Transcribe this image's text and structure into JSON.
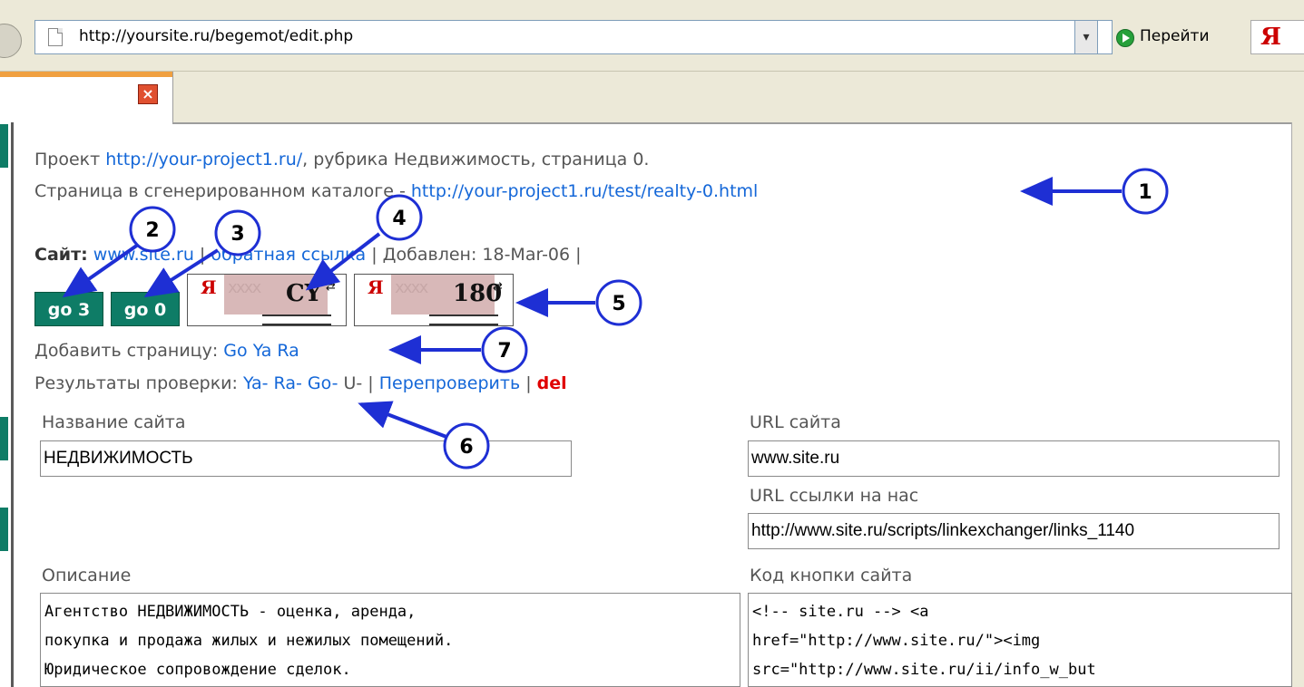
{
  "browser": {
    "address": "http://yoursite.ru/begemot/edit.php",
    "go_label": "Перейти",
    "search_logo": "Я",
    "dropdown_glyph": "▾",
    "tab_close_glyph": "×"
  },
  "project": {
    "label": "Проект",
    "url": "http://your-project1.ru/",
    "rubric_text": ", рубрика Недвижимость, страница 0.",
    "catalog_label": "Страница в сгенерированном каталоге -",
    "catalog_url": "http://your-project1.ru/test/realty-0.html"
  },
  "site": {
    "label": "Сайт:",
    "url": "www.site.ru",
    "sep1": "|",
    "backlink": "обратная ссылка",
    "added": "| Добавлен: 18-Mar-06 |"
  },
  "buttons": {
    "go3": "go 3",
    "go0": "go 0",
    "yandex_cy": "CY",
    "yandex_cy_letter": "Я",
    "yandex_180": "180",
    "yandex_180_letter": "Я",
    "refresh_glyph": "⇄"
  },
  "add_page": {
    "label": "Добавить страницу:",
    "links": [
      "Go",
      "Ya",
      "Ra"
    ]
  },
  "check_results": {
    "label": "Результаты проверки:",
    "ya": "Ya-",
    "ra": "Ra-",
    "go": "Go-",
    "u": "U-",
    "sep": "|",
    "recheck": "Перепроверить",
    "sep2": "|",
    "del": "del"
  },
  "form": {
    "site_name_label": "Название сайта",
    "site_name_value": "НЕДВИЖИМОСТЬ",
    "site_url_label": "URL сайта",
    "site_url_value": "www.site.ru",
    "backlink_url_label": "URL ссылки на нас",
    "backlink_url_value": "http://www.site.ru/scripts/linkexchanger/links_1140",
    "description_label": "Описание",
    "description_value": "Агентство НЕДВИЖИМОСТЬ - оценка, аренда,\nпокупка и продажа жилых и нежилых помещений.\nЮридическое сопровождение сделок.",
    "button_code_label": "Код кнопки сайта",
    "button_code_value": "<!-- site.ru --> <a\nhref=\"http://www.site.ru/\"><img\nsrc=\"http://www.site.ru/ii/info_w_but"
  },
  "annotations": [
    "1",
    "2",
    "3",
    "4",
    "5",
    "6",
    "7"
  ],
  "colors": {
    "link": "#1467d8",
    "arrow": "#1e2fd4",
    "go_button": "#0e7c66",
    "del": "#e00000"
  }
}
